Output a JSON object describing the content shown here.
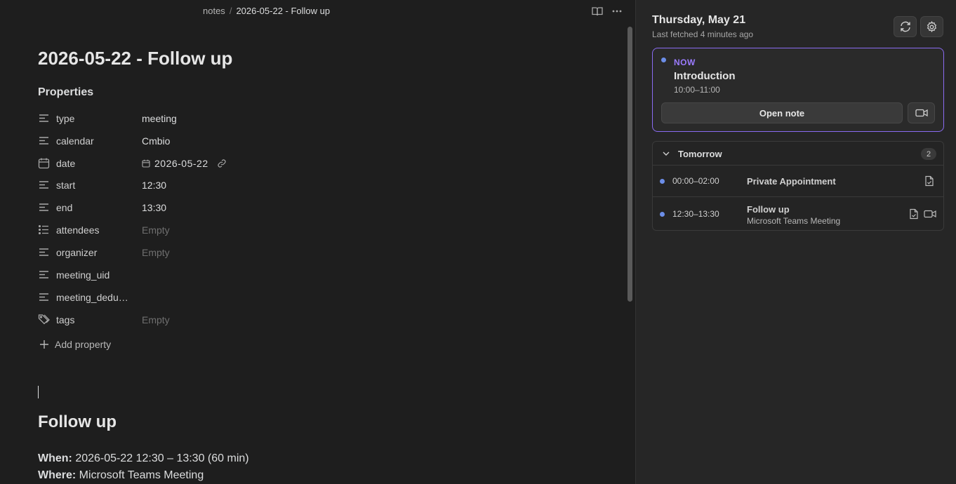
{
  "editor": {
    "breadcrumb": {
      "folder": "notes",
      "separator": "/",
      "current": "2026-05-22 - Follow up"
    },
    "title": "2026-05-22 - Follow up",
    "properties_heading": "Properties",
    "properties": [
      {
        "icon": "text-lines-icon",
        "key": "type",
        "value": "meeting",
        "empty": false
      },
      {
        "icon": "text-lines-icon",
        "key": "calendar",
        "value": "Cmbio",
        "empty": false
      },
      {
        "icon": "calendar-icon",
        "key": "date",
        "value": "2026-05-22",
        "empty": false
      },
      {
        "icon": "text-lines-icon",
        "key": "start",
        "value": "12:30",
        "empty": false
      },
      {
        "icon": "text-lines-icon",
        "key": "end",
        "value": "13:30",
        "empty": false
      },
      {
        "icon": "list-icon",
        "key": "attendees",
        "value": "Empty",
        "empty": true
      },
      {
        "icon": "text-lines-icon",
        "key": "organizer",
        "value": "Empty",
        "empty": true
      },
      {
        "icon": "text-lines-icon",
        "key": "meeting_uid",
        "value": "",
        "empty": false
      },
      {
        "icon": "text-lines-icon",
        "key": "meeting_dedu…",
        "value": "",
        "empty": false
      },
      {
        "icon": "tag-icon",
        "key": "tags",
        "value": "Empty",
        "empty": true
      }
    ],
    "add_property_label": "Add property",
    "body_heading": "Follow up",
    "when_label": "When:",
    "when_value": " 2026-05-22 12:30 – 13:30 (60 min)",
    "where_label": "Where:",
    "where_value": " Microsoft Teams Meeting"
  },
  "panel": {
    "date": "Thursday, May 21",
    "last_fetched": "Last fetched 4 minutes ago",
    "now_card": {
      "label": "NOW",
      "title": "Introduction",
      "time": "10:00–11:00",
      "open_note_label": "Open note"
    },
    "tomorrow": {
      "label": "Tomorrow",
      "count": "2",
      "events": [
        {
          "time": "00:00–02:00",
          "title": "Private Appointment",
          "subtitle": ""
        },
        {
          "time": "12:30–13:30",
          "title": "Follow up",
          "subtitle": "Microsoft Teams Meeting"
        }
      ]
    }
  },
  "colors": {
    "accent_purple": "#8a6bf2",
    "now_label": "#9b7bff",
    "event_dot": "#6c8ee8",
    "background": "#1e1e1e",
    "panel_background": "#262626"
  }
}
